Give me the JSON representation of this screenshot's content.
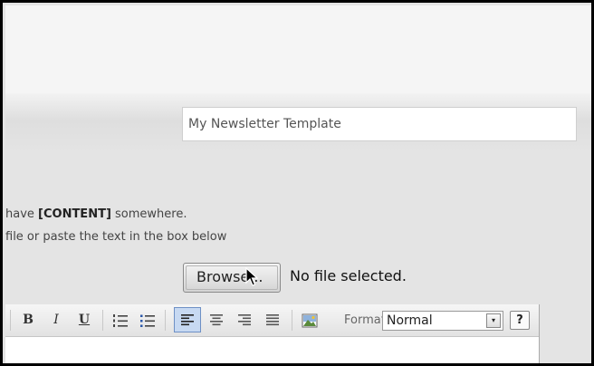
{
  "template_name": {
    "value": "My Newsletter Template"
  },
  "help": {
    "line1_prefix": "have ",
    "line1_token": "[CONTENT]",
    "line1_suffix": " somewhere.",
    "line2": "file or paste the text in the box below"
  },
  "file_upload": {
    "browse_label": "Browse...",
    "status": "No file selected."
  },
  "toolbar": {
    "bold_label": "B",
    "italic_label": "I",
    "underline_label": "U",
    "format_label": "Format",
    "format_value": "Normal",
    "format_arrow": "▾",
    "help_label": "?",
    "icons": [
      "bold-icon",
      "italic-icon",
      "underline-icon",
      "ordered-list-icon",
      "unordered-list-icon",
      "align-left-icon",
      "align-center-icon",
      "align-right-icon",
      "align-justify-icon",
      "insert-image-icon",
      "help-icon"
    ],
    "active_button": "align-left"
  },
  "colors": {
    "active_button_bg": "#c7d9f2",
    "active_button_border": "#6e90c5"
  }
}
